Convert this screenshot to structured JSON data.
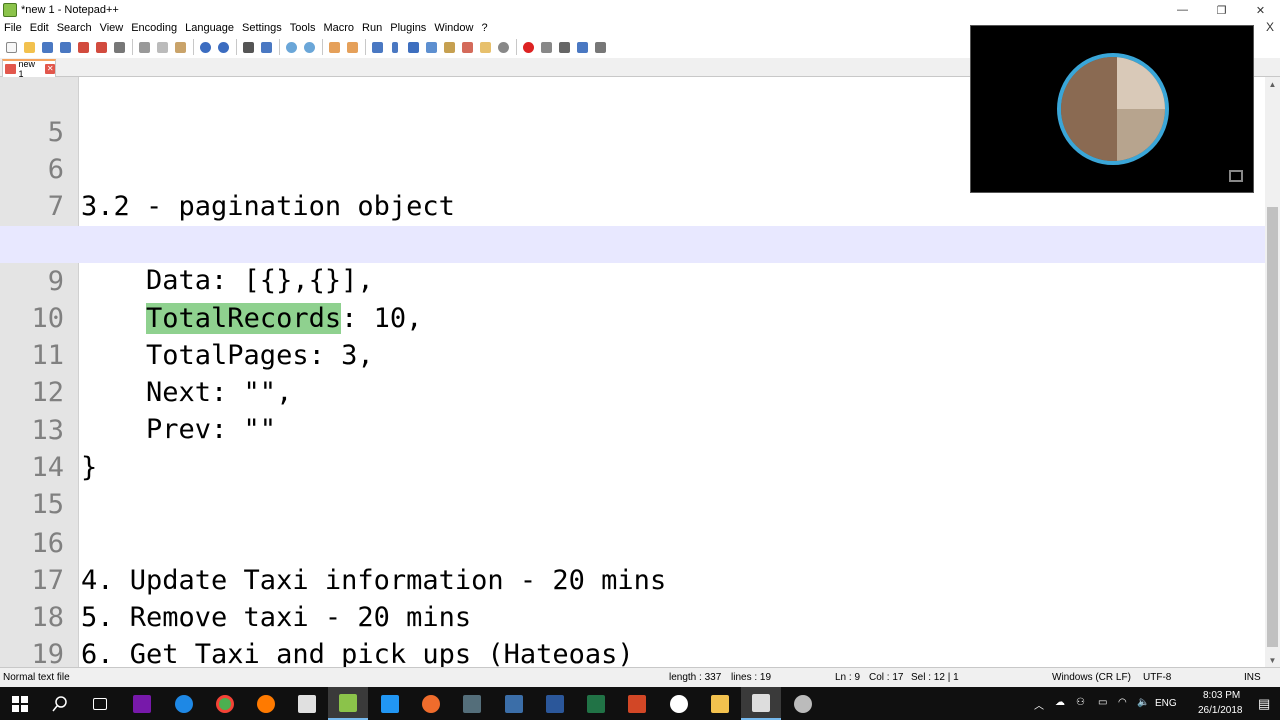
{
  "window": {
    "title": "*new 1 - Notepad++",
    "minimize": "—",
    "restore": "❐",
    "close": "✕"
  },
  "menu": [
    "File",
    "Edit",
    "Search",
    "View",
    "Encoding",
    "Language",
    "Settings",
    "Tools",
    "Macro",
    "Run",
    "Plugins",
    "Window",
    "?"
  ],
  "menu_close": "X",
  "tab": {
    "label": "new 1",
    "close": "✕"
  },
  "editor": {
    "current_line": 9,
    "lines": [
      {
        "n": "5",
        "text": ""
      },
      {
        "n": "6",
        "text": "3.2 - pagination object"
      },
      {
        "n": "7",
        "text": "{"
      },
      {
        "n": "8",
        "text": "    Data: [{},{}],"
      },
      {
        "n": "9",
        "pre": "    ",
        "sel": "TotalRecords",
        "post": ": 10,"
      },
      {
        "n": "10",
        "text": "    TotalPages: 3,"
      },
      {
        "n": "11",
        "text": "    Next: \"\","
      },
      {
        "n": "12",
        "text": "    Prev: \"\""
      },
      {
        "n": "13",
        "text": "}"
      },
      {
        "n": "14",
        "text": ""
      },
      {
        "n": "15",
        "text": ""
      },
      {
        "n": "16",
        "text": "4. Update Taxi information - 20 mins"
      },
      {
        "n": "17",
        "text": "5. Remove taxi - 20 mins"
      },
      {
        "n": "18",
        "text": "6. Get Taxi and pick ups (Hateoas)"
      },
      {
        "n": "19",
        "text": ""
      }
    ]
  },
  "status": {
    "file_type": "Normal text file",
    "length": "length : 337",
    "lines": "lines : 19",
    "ln": "Ln : 9",
    "col": "Col : 17",
    "sel": "Sel : 12 | 1",
    "eol": "Windows (CR LF)",
    "encoding": "UTF-8",
    "mode": "INS"
  },
  "taskbar": {
    "lang": "ENG",
    "time": "8:03 PM",
    "date": "26/1/2018"
  },
  "colors": {
    "selection": "#8fd18f",
    "current_line": "#e8e8ff",
    "gutter": "#e4e4e4",
    "taskbar": "#101010"
  }
}
